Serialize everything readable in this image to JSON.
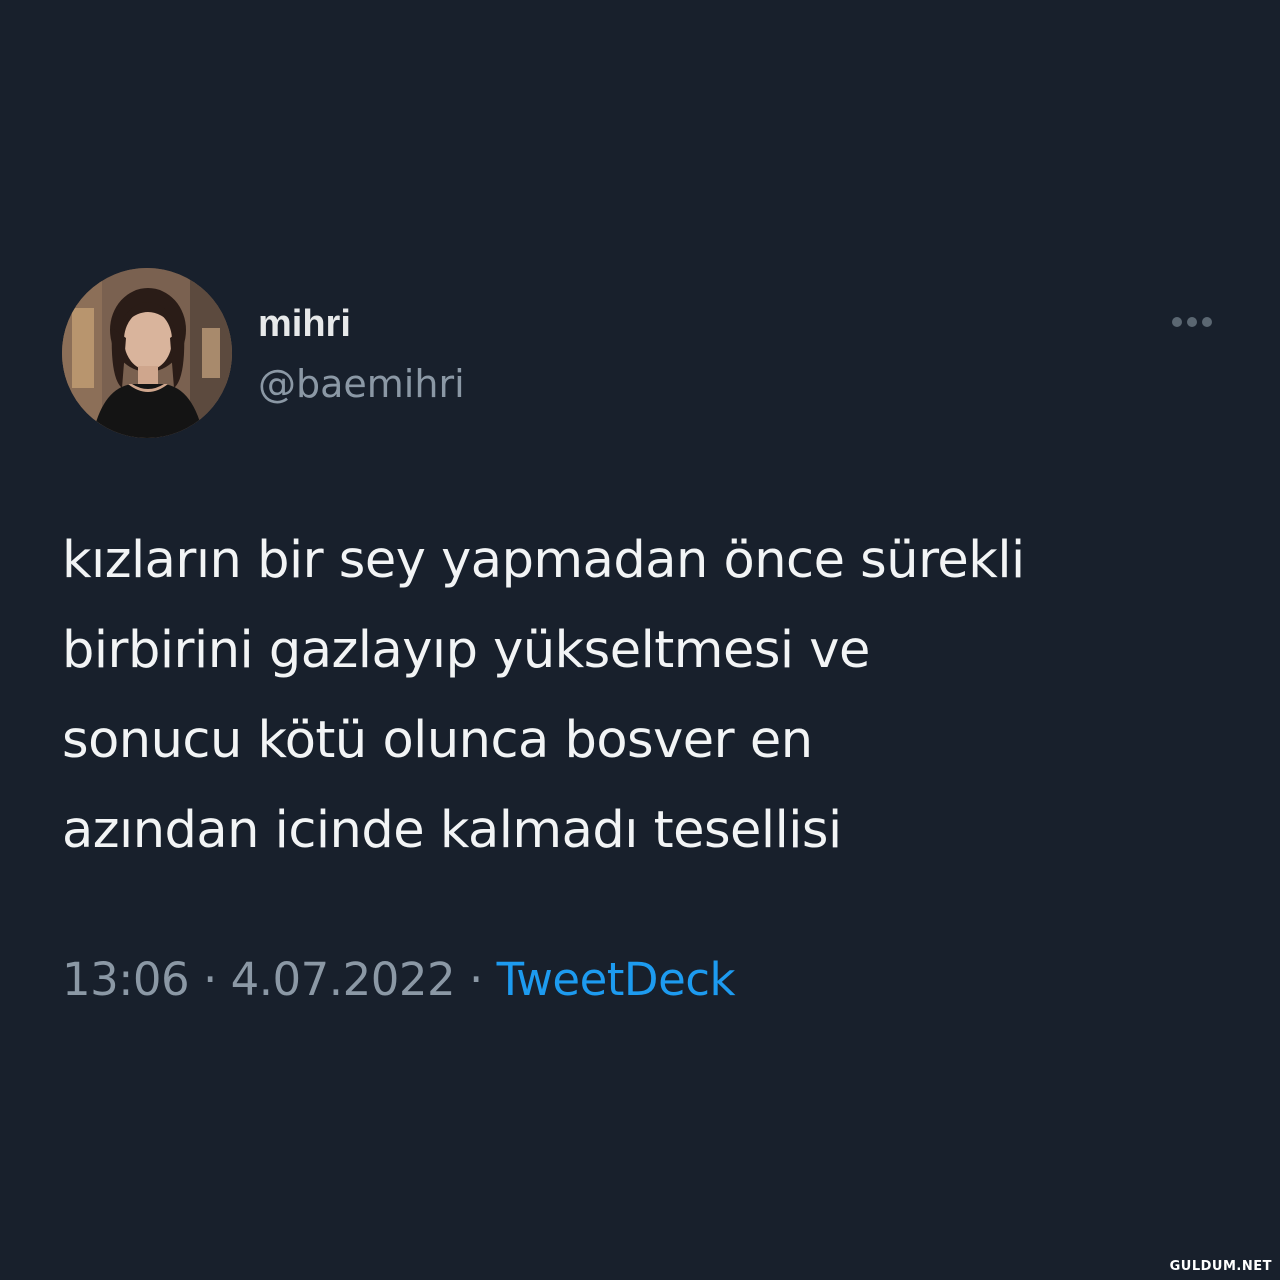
{
  "user": {
    "display_name": "mihri",
    "handle": "@baemihri",
    "avatar_icon": "profile-photo"
  },
  "tweet": {
    "lines": [
      "kızların bir sey yapmadan önce sürekli",
      "birbirini gazlayıp yükseltmesi ve",
      "sonucu kötü olunca bosver en",
      "azından icinde kalmadı tesellisi"
    ],
    "time": "13:06",
    "separator1": " · ",
    "date": "4.07.2022",
    "separator2": " · ",
    "source": "TweetDeck"
  },
  "menu": {
    "more_icon": "ellipsis-icon"
  },
  "watermark": "GULDUM.NET",
  "colors": {
    "background": "#18202c",
    "primary_text": "#e7e9ea",
    "secondary_text": "#8b98a5",
    "link": "#1d9bf0"
  }
}
